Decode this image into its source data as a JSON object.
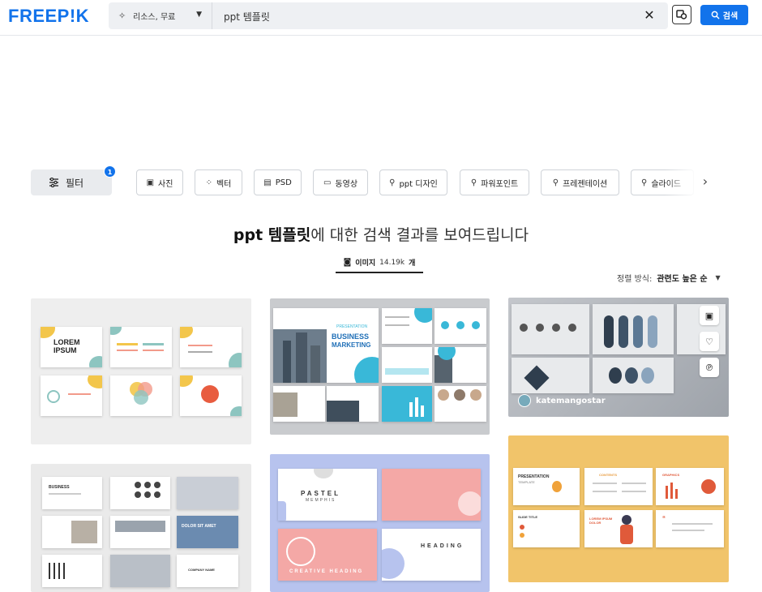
{
  "header": {
    "logo": "FREEP!K",
    "source_select": "리소스, 무료",
    "query": "ppt 템플릿",
    "search_button": "검색"
  },
  "filters": {
    "filter_button": "필터",
    "badge_count": "1",
    "chips": [
      {
        "label": "사진",
        "icon": "photo-icon"
      },
      {
        "label": "벡터",
        "icon": "vector-icon"
      },
      {
        "label": "PSD",
        "icon": "psd-icon"
      },
      {
        "label": "동영상",
        "icon": "video-icon"
      },
      {
        "label": "ppt 디자인",
        "icon": "search-icon"
      },
      {
        "label": "파워포인트",
        "icon": "search-icon"
      },
      {
        "label": "프레젠테이션",
        "icon": "search-icon"
      },
      {
        "label": "슬라이드",
        "icon": "search-icon"
      }
    ]
  },
  "results": {
    "title_bold": "ppt 템플릿",
    "title_rest": "에 대한 검색 결과를 보여드립니다",
    "tab_label": "이미지",
    "tab_count": "14.19k",
    "tab_unit": "개",
    "sort_label": "정렬 방식:",
    "sort_value": "관련도 높은 순"
  },
  "cards": {
    "c1": {
      "title": "LOREM\nIPSUM"
    },
    "c2": {
      "tag": "PRESENTATION",
      "title1": "BUSINESS",
      "title2": "MARKETING"
    },
    "c3": {
      "author": "katemangostar"
    },
    "c5": {
      "title1": "PASTEL",
      "title2": "MEMPHIS",
      "heading": "HEADING",
      "creative": "CREATIVE HEADING"
    },
    "c6": {
      "title": "PRESENTATION",
      "sub": "TEMPLATE",
      "contents": "CONTENTS",
      "graphics": "GRAPHICS",
      "slide": "SLIDE TITLE",
      "lorem": "LOREM IPSUM DOLOR"
    },
    "c4": {
      "title": "BUSINESS",
      "dolor": "DOLOR SIT AMET",
      "company": "COMPANY NAME"
    }
  },
  "colors": {
    "brand_blue": "#1273eb",
    "card1_bg": "#eeeeee",
    "card5_bg": "#b7c3ee",
    "card6_bg": "#f1c46a"
  }
}
